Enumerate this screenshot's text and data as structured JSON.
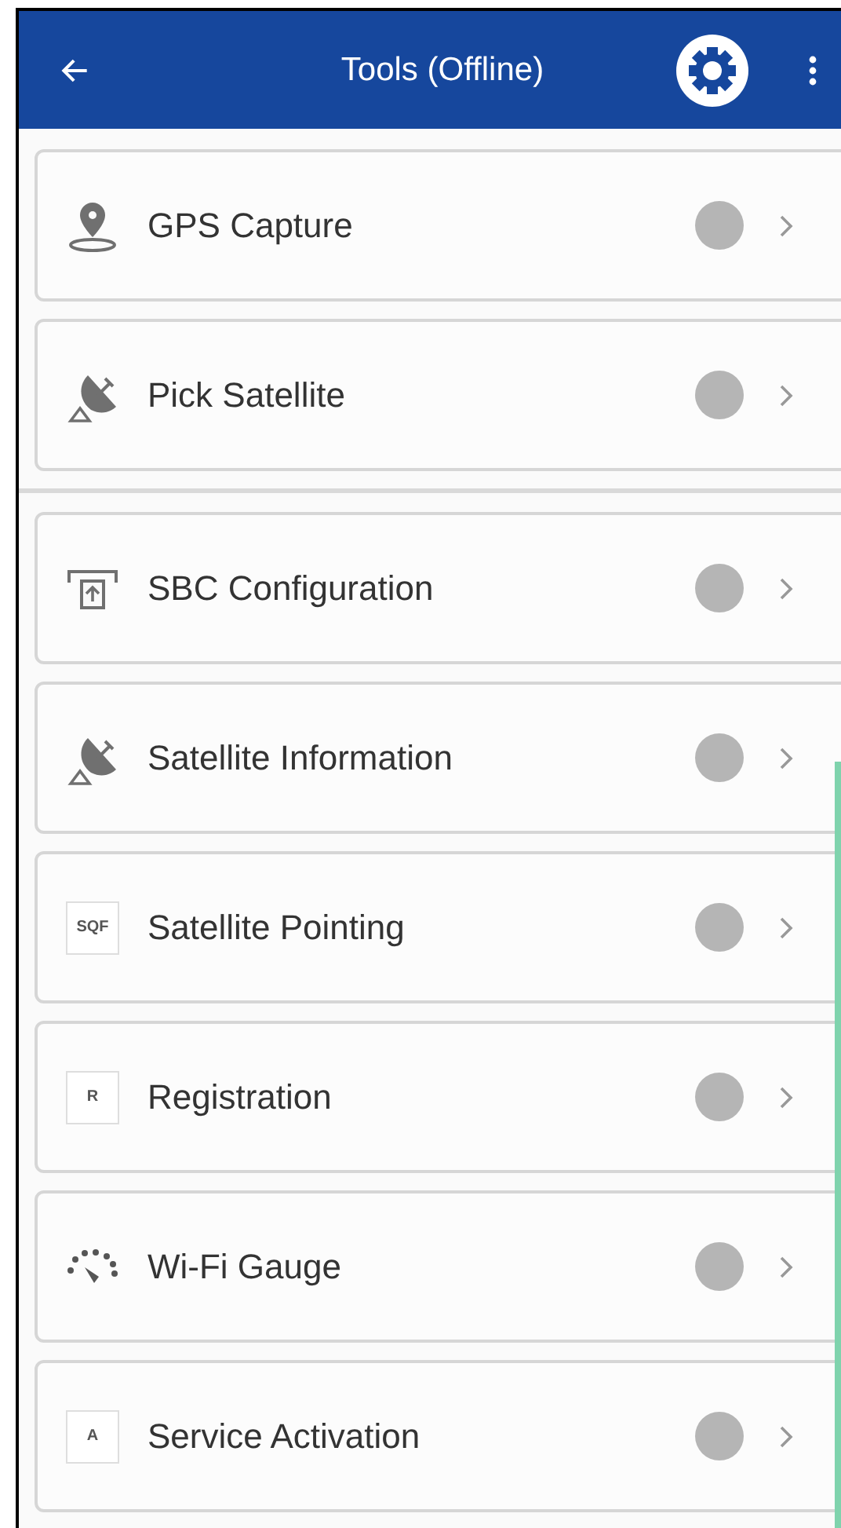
{
  "header": {
    "title": "Tools (Offline)"
  },
  "sections": [
    {
      "items": [
        {
          "kind": "pin",
          "label": "GPS Capture"
        },
        {
          "kind": "dish",
          "label": "Pick Satellite"
        }
      ]
    },
    {
      "items": [
        {
          "kind": "device",
          "label": "SBC Configuration"
        },
        {
          "kind": "dish",
          "label": "Satellite Information"
        },
        {
          "kind": "letter",
          "icon_text": "SQF",
          "label": "Satellite Pointing"
        },
        {
          "kind": "letter",
          "icon_text": "R",
          "label": "Registration"
        },
        {
          "kind": "gauge",
          "label": "Wi-Fi Gauge"
        },
        {
          "kind": "letter",
          "icon_text": "A",
          "label": "Service Activation"
        }
      ]
    }
  ]
}
